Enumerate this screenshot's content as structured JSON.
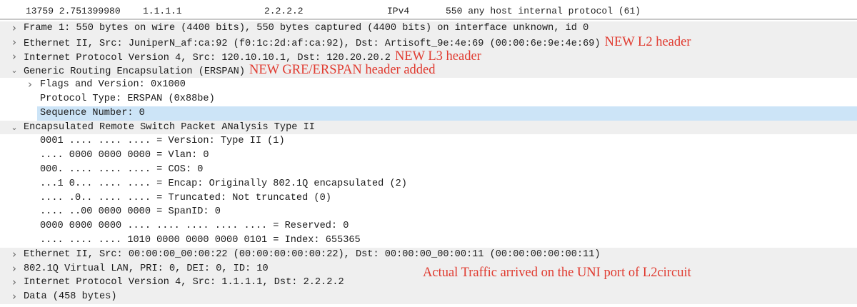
{
  "packet_row": {
    "no_time": "13759 2.751399980",
    "source": "1.1.1.1",
    "destination": "2.2.2.2",
    "protocol": "IPv4",
    "info": "550 any host internal protocol (61)"
  },
  "tree": [
    {
      "level": 0,
      "expander": "collapsed",
      "text": "Frame 1: 550 bytes on wire (4400 bits), 550 bytes captured (4400 bits) on interface unknown, id 0"
    },
    {
      "level": 0,
      "expander": "collapsed",
      "text": "Ethernet II, Src: JuniperN_af:ca:92 (f0:1c:2d:af:ca:92), Dst: Artisoft_9e:4e:69 (00:00:6e:9e:4e:69)",
      "note": "NEW L2 header"
    },
    {
      "level": 0,
      "expander": "collapsed",
      "text": "Internet Protocol Version 4, Src: 120.10.10.1, Dst: 120.20.20.2",
      "note": "NEW L3 header"
    },
    {
      "level": 0,
      "expander": "expanded",
      "text": "Generic Routing Encapsulation (ERSPAN)",
      "note": "NEW GRE/ERSPAN header added"
    },
    {
      "level": 1,
      "expander": "collapsed",
      "text": "Flags and Version: 0x1000"
    },
    {
      "level": 1,
      "expander": "none",
      "text": "Protocol Type: ERSPAN (0x88be)"
    },
    {
      "level": 1,
      "expander": "none",
      "text": "Sequence Number: 0",
      "selected": true
    },
    {
      "level": 0,
      "expander": "expanded",
      "text": "Encapsulated Remote Switch Packet ANalysis Type II"
    },
    {
      "level": 1,
      "expander": "none",
      "text": "0001 .... .... .... = Version: Type II (1)"
    },
    {
      "level": 1,
      "expander": "none",
      "text": ".... 0000 0000 0000 = Vlan: 0"
    },
    {
      "level": 1,
      "expander": "none",
      "text": "000. .... .... .... = COS: 0"
    },
    {
      "level": 1,
      "expander": "none",
      "text": "...1 0... .... .... = Encap: Originally 802.1Q encapsulated (2)"
    },
    {
      "level": 1,
      "expander": "none",
      "text": ".... .0.. .... .... = Truncated: Not truncated (0)"
    },
    {
      "level": 1,
      "expander": "none",
      "text": ".... ..00 0000 0000 = SpanID: 0"
    },
    {
      "level": 1,
      "expander": "none",
      "text": "0000 0000 0000 .... .... .... .... .... = Reserved: 0"
    },
    {
      "level": 1,
      "expander": "none",
      "text": ".... .... .... 1010 0000 0000 0000 0101 = Index: 655365"
    },
    {
      "level": 0,
      "expander": "collapsed",
      "text": "Ethernet II, Src: 00:00:00_00:00:22 (00:00:00:00:00:22), Dst: 00:00:00_00:00:11 (00:00:00:00:00:11)"
    },
    {
      "level": 0,
      "expander": "collapsed",
      "text": "802.1Q Virtual LAN, PRI: 0, DEI: 0, ID: 10"
    },
    {
      "level": 0,
      "expander": "collapsed",
      "text": "Internet Protocol Version 4, Src: 1.1.1.1, Dst: 2.2.2.2"
    },
    {
      "level": 0,
      "expander": "collapsed",
      "text": "Data (458 bytes)"
    }
  ],
  "annotations": {
    "actual_traffic": "Actual Traffic arrived on the UNI port of L2circuit"
  },
  "colors": {
    "annotation": "#e03a2f",
    "selection": "#cce4f7"
  }
}
